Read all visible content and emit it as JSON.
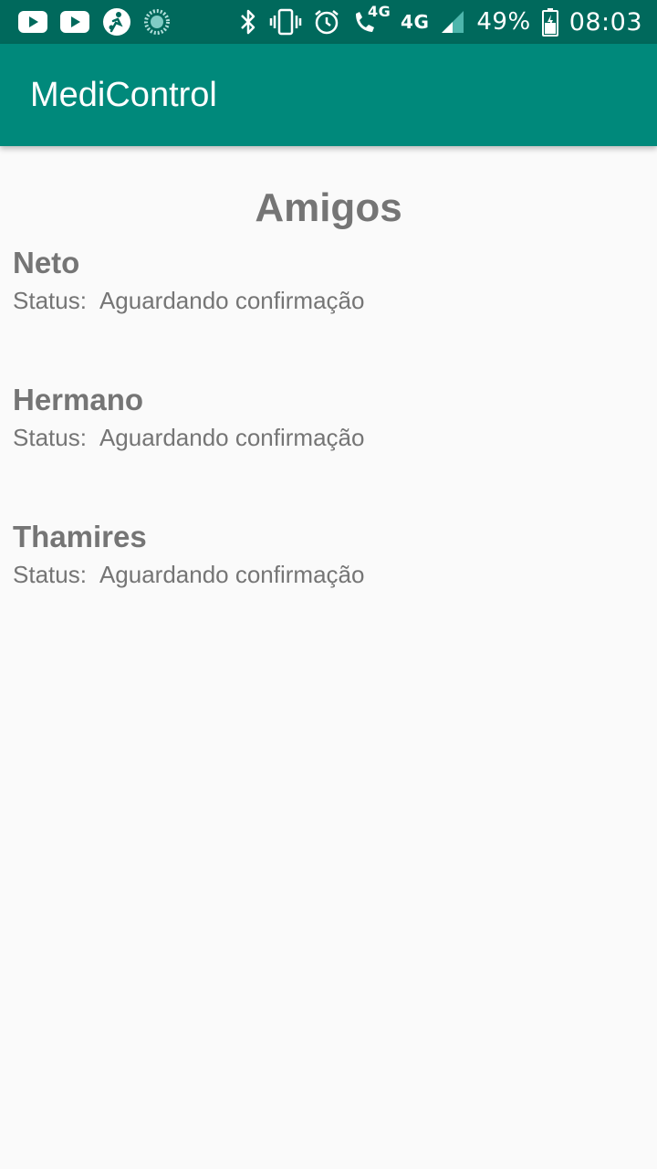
{
  "status_bar": {
    "network": "4G",
    "call_network": "4G",
    "battery_percent": "49%",
    "time": "08:03",
    "icons": [
      "youtube-icon",
      "youtube-icon",
      "soccer-app-icon",
      "loading-circle-icon",
      "bluetooth-icon",
      "vibrate-icon",
      "alarm-icon",
      "wifi-call-icon",
      "signal-icon",
      "battery-icon"
    ]
  },
  "app_bar": {
    "title": "MediControl",
    "color": "#00897b"
  },
  "page": {
    "title": "Amigos"
  },
  "friends": [
    {
      "name": "Neto",
      "status_label": "Status:",
      "status_value": "Aguardando confirmação"
    },
    {
      "name": "Hermano",
      "status_label": "Status:",
      "status_value": "Aguardando confirmação"
    },
    {
      "name": "Thamires",
      "status_label": "Status:",
      "status_value": "Aguardando confirmação"
    }
  ]
}
